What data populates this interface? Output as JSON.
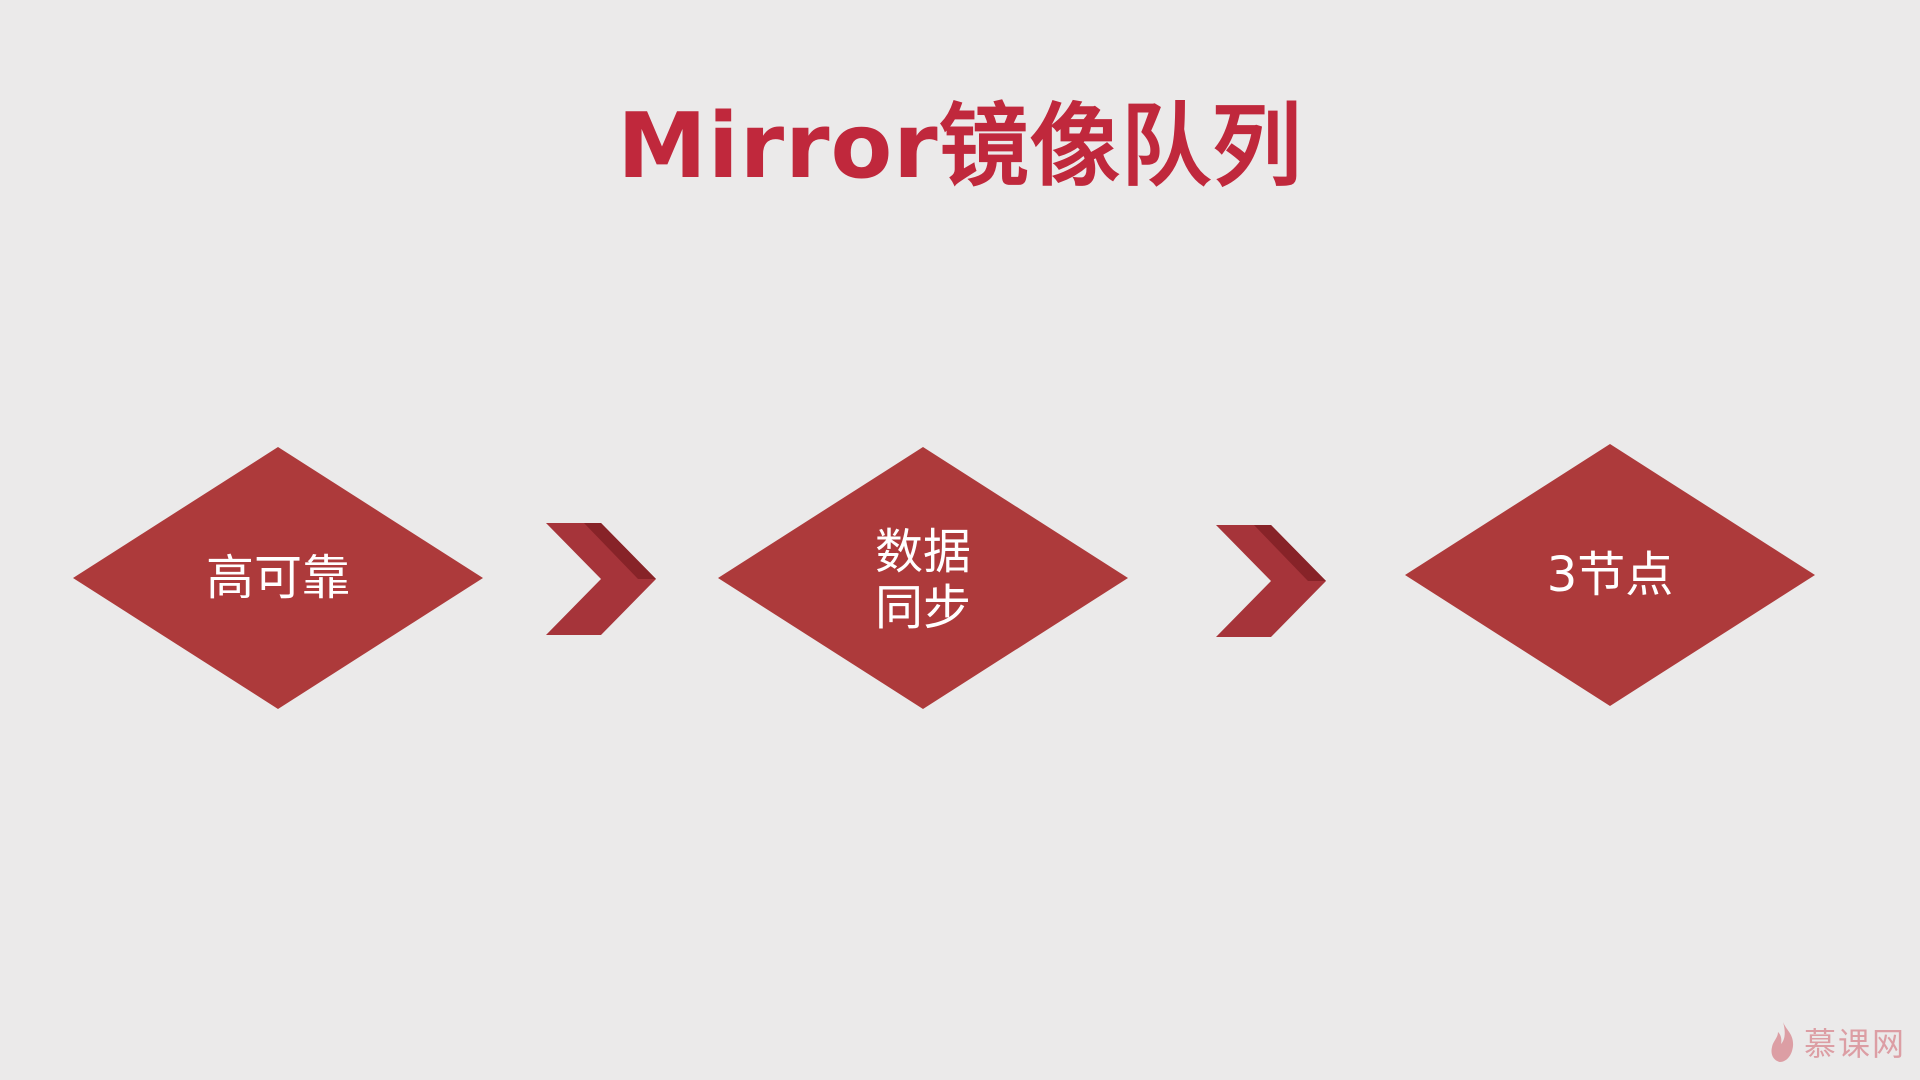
{
  "slide": {
    "title": "Mirror镜像队列",
    "steps": [
      {
        "label": "高可靠"
      },
      {
        "label": "数据\n同步"
      },
      {
        "label": "3节点"
      }
    ],
    "watermark": "慕课网"
  },
  "colors": {
    "title": "#c0283c",
    "diamond": "#ad3a3b",
    "arrow": "#a6343a",
    "arrow_shade": "#872328",
    "background": "#ebeaea",
    "watermark": "#d77e87"
  },
  "icons": {
    "diamond": "diamond-shape",
    "arrow": "chevron-right-icon",
    "watermark": "flame-icon"
  }
}
